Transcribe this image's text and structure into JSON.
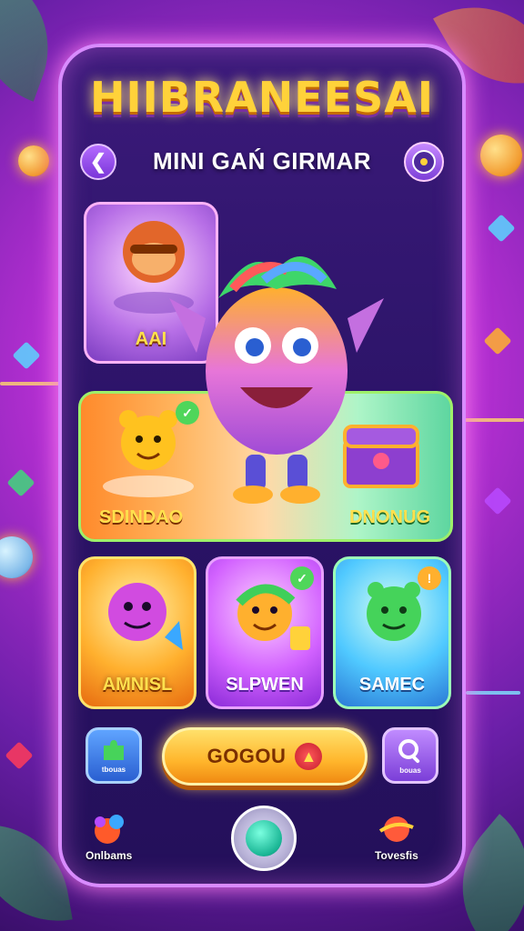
{
  "header": {
    "title": "HIIBRANEESAI",
    "subtitle": "MINI GAŃ GIRMAR",
    "back_icon": "chevron-left-icon",
    "right_icon": "disc-icon"
  },
  "cards": {
    "top_small": {
      "label": "AAI",
      "icon": "monkey-character-icon"
    },
    "wide": {
      "left_label": "SDINDAO",
      "right_label": "DNONUG",
      "left_icon": "bear-character-icon",
      "right_icon": "treasure-chest-icon"
    },
    "row": [
      {
        "label": "AMNISL",
        "icon": "purple-creature-icon"
      },
      {
        "label": "SLPWEN",
        "icon": "lion-character-icon"
      },
      {
        "label": "SAMEC",
        "icon": "green-dino-icon"
      }
    ]
  },
  "bottom": {
    "left_button_label": "tbouas",
    "go_button_label": "GOGOU",
    "right_button_label": "bouas",
    "left_corner_label": "Onlbams",
    "right_corner_label": "Tovesfis"
  },
  "colors": {
    "accent_yellow": "#ffd23a",
    "frame_pink": "#d98bff",
    "background_purple": "#b42fd1"
  }
}
